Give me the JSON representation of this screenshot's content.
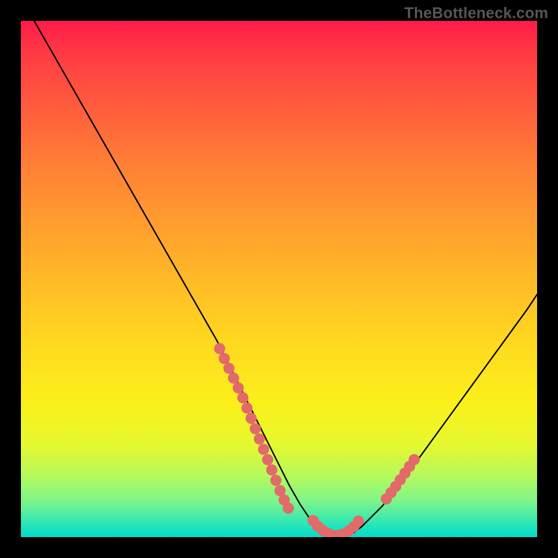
{
  "watermark": "TheBottleneck.com",
  "chart_data": {
    "type": "line",
    "title": "",
    "xlabel": "",
    "ylabel": "",
    "xlim": [
      0,
      100
    ],
    "ylim": [
      0,
      100
    ],
    "series": [
      {
        "name": "main-curve",
        "x": [
          2,
          6,
          10,
          14,
          18,
          22,
          26,
          30,
          34,
          38,
          42,
          44,
          46,
          48,
          50,
          52,
          54,
          56,
          58,
          60,
          62,
          64,
          66,
          70,
          74,
          78,
          82,
          86,
          90,
          94,
          98,
          100
        ],
        "values": [
          101,
          94,
          87,
          80,
          73,
          66,
          59,
          52,
          45,
          38,
          30,
          26,
          22,
          18,
          14,
          10,
          6.5,
          3.5,
          1.5,
          0.5,
          0,
          0.5,
          2,
          6,
          11,
          16.5,
          22,
          27.5,
          33,
          38.5,
          44,
          47
        ]
      },
      {
        "name": "marker-cluster-left",
        "x": [
          38.5,
          39.4,
          40.3,
          41.2,
          42.1,
          43.0,
          43.8,
          44.6,
          45.4,
          46.2,
          47.0,
          47.8,
          48.6,
          49.4,
          50.2,
          51.0,
          51.8
        ],
        "values": [
          36.5,
          34.6,
          32.7,
          30.8,
          28.9,
          27.0,
          25.0,
          23.0,
          21.0,
          19.0,
          17.0,
          15.0,
          13.0,
          11.0,
          9.0,
          7.2,
          5.6
        ]
      },
      {
        "name": "marker-cluster-bottom",
        "x": [
          56.6,
          57.5,
          58.5,
          59.5,
          60.5,
          61.5,
          62.5,
          63.5,
          64.5,
          65.4
        ],
        "values": [
          3.2,
          2.1,
          1.3,
          0.7,
          0.3,
          0.3,
          0.6,
          1.2,
          2.0,
          3.1
        ]
      },
      {
        "name": "marker-cluster-right",
        "x": [
          70.8,
          71.7,
          72.6,
          73.5,
          74.4,
          75.3,
          76.2
        ],
        "values": [
          7.4,
          8.6,
          9.8,
          11.1,
          12.4,
          13.7,
          15.0
        ]
      }
    ],
    "marker_color": "#e26a6a",
    "marker_radius_px": 8,
    "curve_color": "#000000",
    "gradient_stops": [
      {
        "pos": 0.0,
        "color": "#ff1a4a"
      },
      {
        "pos": 0.06,
        "color": "#ff3944"
      },
      {
        "pos": 0.16,
        "color": "#ff5a3e"
      },
      {
        "pos": 0.26,
        "color": "#ff7a37"
      },
      {
        "pos": 0.38,
        "color": "#ff9a2f"
      },
      {
        "pos": 0.5,
        "color": "#ffb927"
      },
      {
        "pos": 0.62,
        "color": "#ffd81f"
      },
      {
        "pos": 0.74,
        "color": "#fbf01b"
      },
      {
        "pos": 0.82,
        "color": "#e6f82f"
      },
      {
        "pos": 0.88,
        "color": "#b7f95a"
      },
      {
        "pos": 0.93,
        "color": "#7ef58a"
      },
      {
        "pos": 0.97,
        "color": "#33e7b3"
      },
      {
        "pos": 1.0,
        "color": "#00dccc"
      }
    ]
  }
}
